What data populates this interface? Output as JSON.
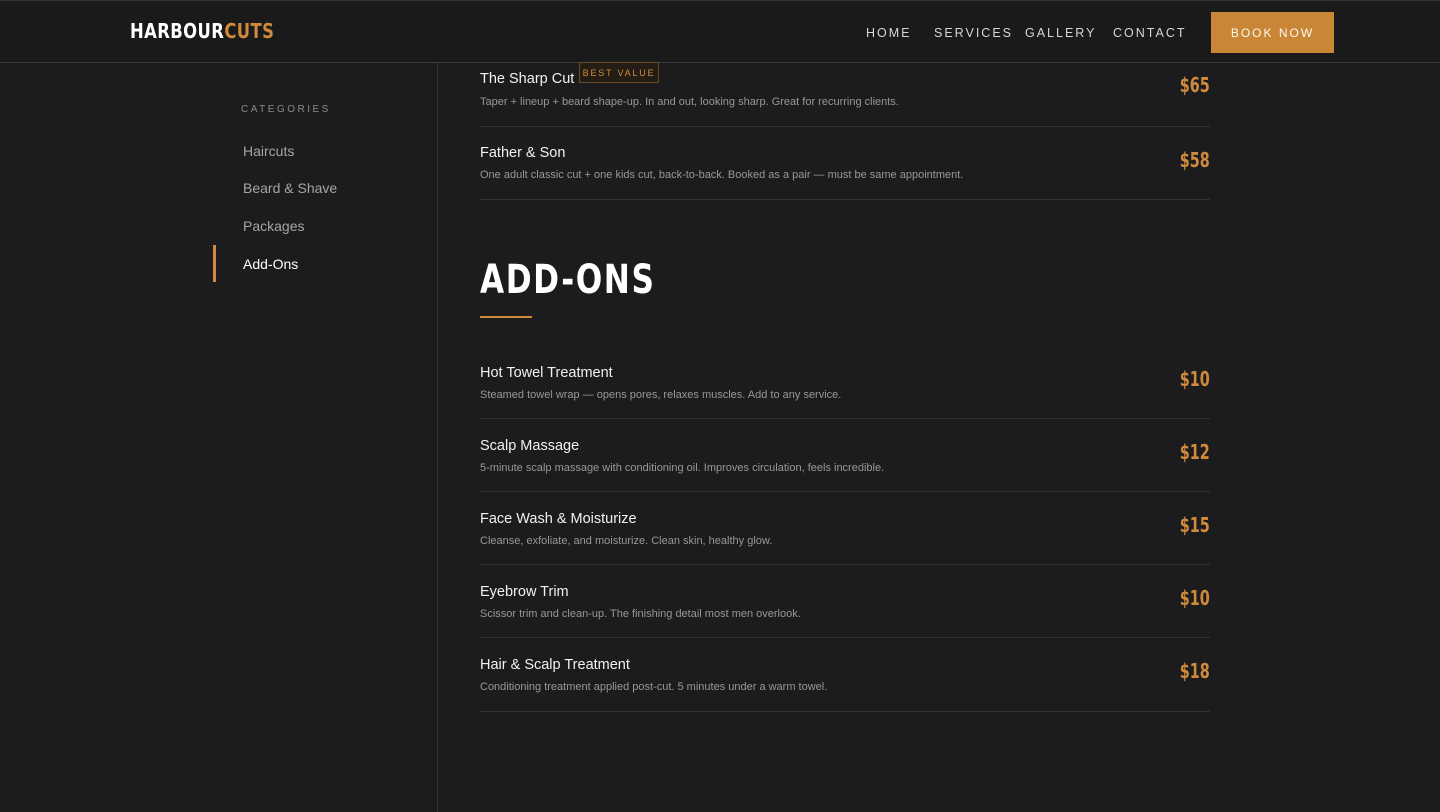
{
  "brand": {
    "logo_part1": "HARBOUR",
    "logo_part2": "CUTS",
    "accent_color": "#d18a3b"
  },
  "nav": {
    "links": [
      "HOME",
      "SERVICES",
      "GALLERY",
      "CONTACT"
    ],
    "cta": "BOOK NOW"
  },
  "sidebar": {
    "heading": "CATEGORIES",
    "items": [
      "Haircuts",
      "Beard & Shave",
      "Packages",
      "Add-Ons"
    ],
    "active": "Add-Ons"
  },
  "packages": [
    {
      "name": "The Sharp Cut",
      "badge": "BEST VALUE",
      "desc": "Taper + lineup + beard shape-up. In and out, looking sharp. Great for recurring clients.",
      "price": "$65"
    },
    {
      "name": "Father & Son",
      "desc": "One adult classic cut + one kids cut, back-to-back. Booked as a pair — must be same appointment.",
      "price": "$58"
    }
  ],
  "addons_section": {
    "title": "ADD-ONS",
    "items": [
      {
        "name": "Hot Towel Treatment",
        "desc": "Steamed towel wrap — opens pores, relaxes muscles. Add to any service.",
        "price": "$10"
      },
      {
        "name": "Scalp Massage",
        "desc": "5-minute scalp massage with conditioning oil. Improves circulation, feels incredible.",
        "price": "$12"
      },
      {
        "name": "Face Wash & Moisturize",
        "desc": "Cleanse, exfoliate, and moisturize. Clean skin, healthy glow.",
        "price": "$15"
      },
      {
        "name": "Eyebrow Trim",
        "desc": "Scissor trim and clean-up. The finishing detail most men overlook.",
        "price": "$10"
      },
      {
        "name": "Hair & Scalp Treatment",
        "desc": "Conditioning treatment applied post-cut. 5 minutes under a warm towel.",
        "price": "$18"
      }
    ]
  }
}
